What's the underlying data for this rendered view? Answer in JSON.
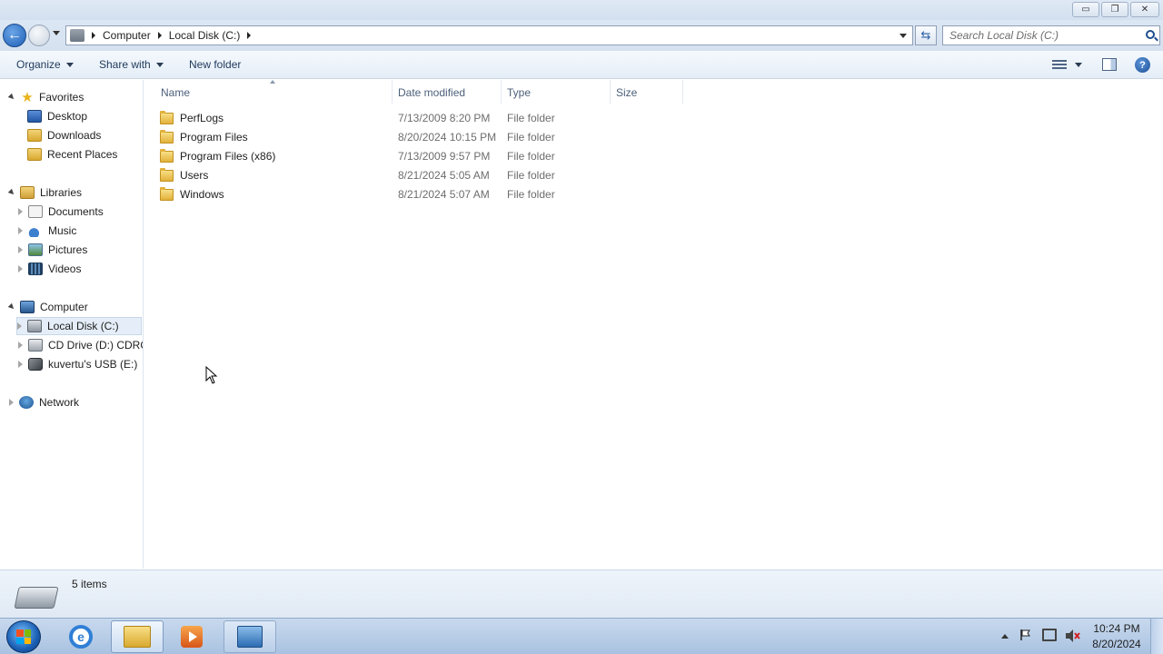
{
  "window": {
    "minimize_label": "▭",
    "maximize_label": "❐",
    "close_label": "✕"
  },
  "address": {
    "crumbs": [
      "Computer",
      "Local Disk (C:)"
    ]
  },
  "search": {
    "placeholder": "Search Local Disk (C:)"
  },
  "toolbar": {
    "organize_label": "Organize",
    "share_label": "Share with",
    "new_folder_label": "New folder"
  },
  "nav": {
    "favorites": "Favorites",
    "desktop": "Desktop",
    "downloads": "Downloads",
    "recent_places": "Recent Places",
    "libraries": "Libraries",
    "documents": "Documents",
    "music": "Music",
    "pictures": "Pictures",
    "videos": "Videos",
    "computer": "Computer",
    "local_disk": "Local Disk (C:)",
    "cd_drive": "CD Drive (D:) CDROM",
    "usb": "kuvertu's USB (E:)",
    "network": "Network"
  },
  "columns": {
    "name": "Name",
    "date_modified": "Date modified",
    "type": "Type",
    "size": "Size"
  },
  "files": [
    {
      "name": "PerfLogs",
      "date": "7/13/2009 8:20 PM",
      "type": "File folder"
    },
    {
      "name": "Program Files",
      "date": "8/20/2024 10:15 PM",
      "type": "File folder"
    },
    {
      "name": "Program Files (x86)",
      "date": "7/13/2009 9:57 PM",
      "type": "File folder"
    },
    {
      "name": "Users",
      "date": "8/21/2024 5:05 AM",
      "type": "File folder"
    },
    {
      "name": "Windows",
      "date": "8/21/2024 5:07 AM",
      "type": "File folder"
    }
  ],
  "details": {
    "item_count": "5 items"
  },
  "clock": {
    "time": "10:24 PM",
    "date": "8/20/2024"
  },
  "colors": {
    "accent": "#1f5fb8",
    "selection": "#e5eef8"
  }
}
